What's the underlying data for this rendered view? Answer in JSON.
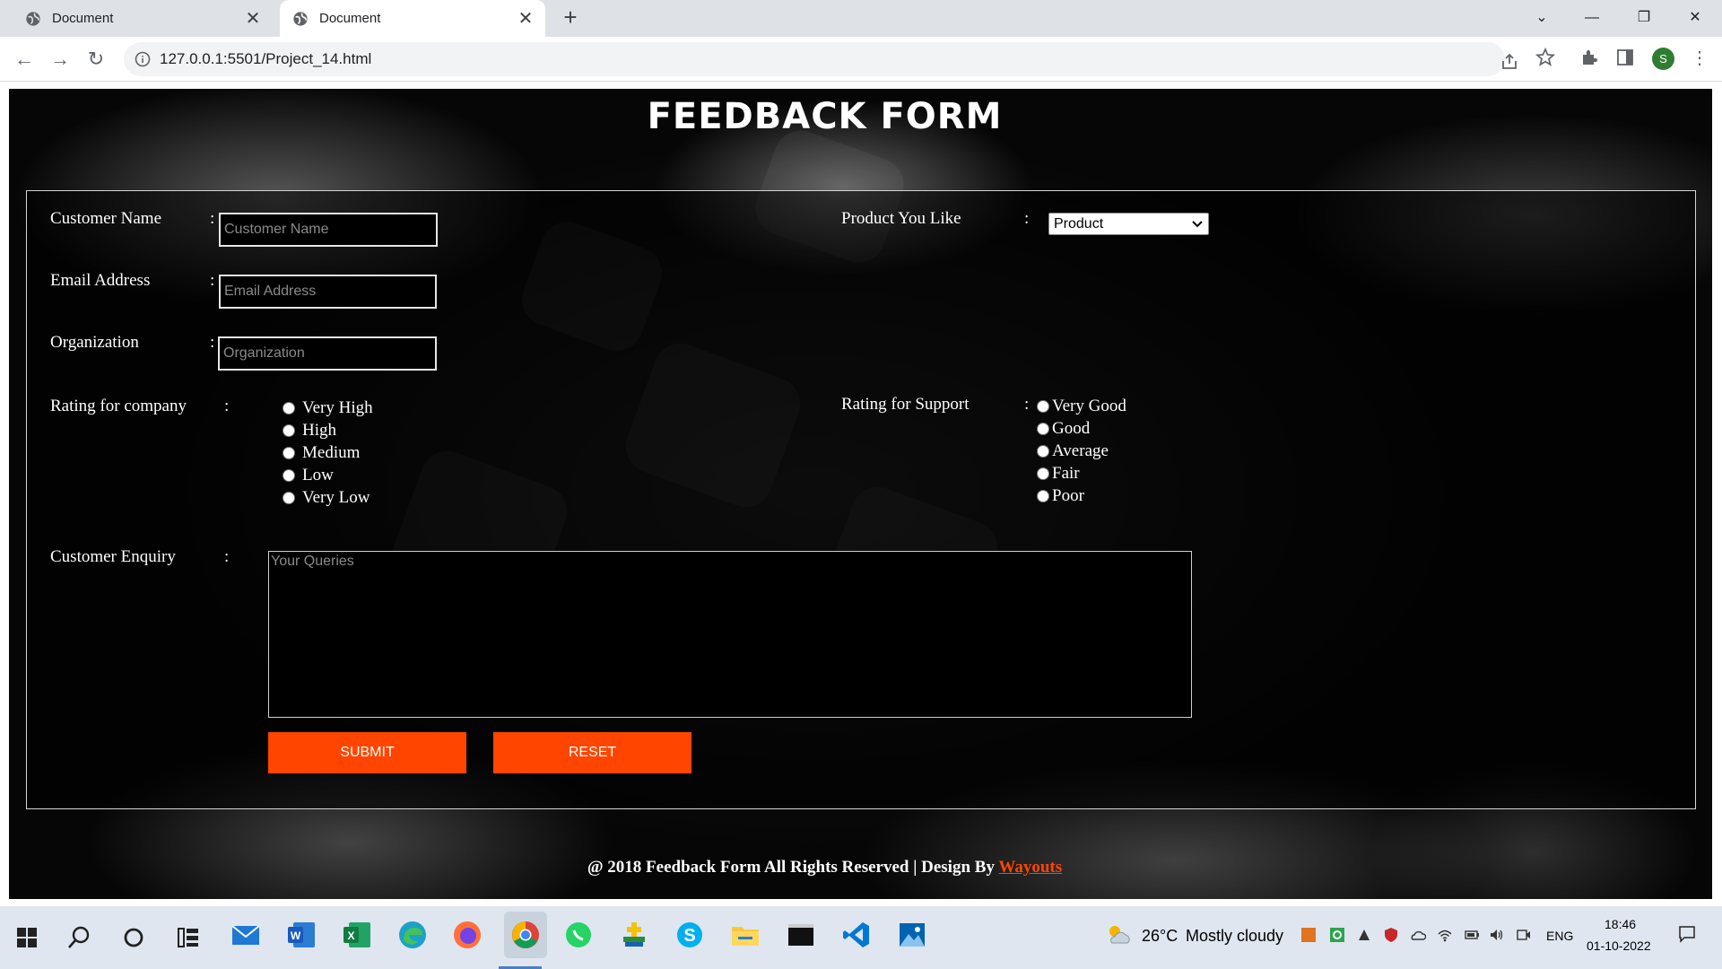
{
  "browser": {
    "tabs": [
      {
        "title": "Document",
        "active": false
      },
      {
        "title": "Document",
        "active": true
      }
    ],
    "url": "127.0.0.1:5501/Project_14.html",
    "profile_initial": "S"
  },
  "form": {
    "title": "FEEDBACK FORM",
    "colon": ":",
    "customer_name": {
      "label": "Customer Name",
      "placeholder": "Customer Name"
    },
    "email": {
      "label": "Email Address",
      "placeholder": "Email Address"
    },
    "organization": {
      "label": "Organization",
      "placeholder": "Organization"
    },
    "product": {
      "label": "Product You Like",
      "selected": "Product"
    },
    "rating_company": {
      "label": "Rating for company",
      "options": [
        "Very High",
        "High",
        "Medium",
        "Low",
        "Very Low"
      ]
    },
    "rating_support": {
      "label": "Rating for Support",
      "options": [
        "Very Good",
        "Good",
        "Average",
        "Fair",
        "Poor"
      ]
    },
    "enquiry": {
      "label": "Customer Enquiry",
      "placeholder": "Your Queries"
    },
    "submit_label": "SUBMIT",
    "reset_label": "RESET",
    "accent_color": "#ff4500"
  },
  "footer": {
    "text": "@ 2018 Feedback Form All Rights Reserved | Design By ",
    "link_text": "Wayouts"
  },
  "taskbar": {
    "weather_temp": "26°C",
    "weather_desc": "Mostly cloudy",
    "language": "ENG",
    "time": "18:46",
    "date": "01-10-2022"
  }
}
